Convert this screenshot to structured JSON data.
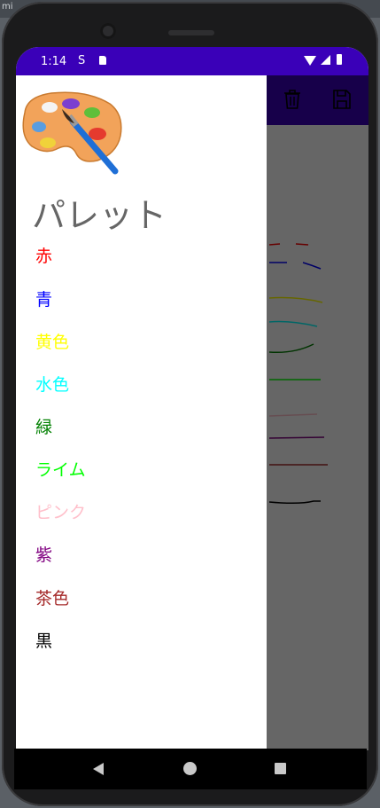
{
  "ide": {
    "label": "mi"
  },
  "status_bar": {
    "time": "1:14",
    "sync_icon": "S"
  },
  "app_bar": {
    "actions": [
      "trash-icon",
      "save-icon"
    ]
  },
  "drawer": {
    "title": "パレット",
    "logo": "palette-icon",
    "items": [
      {
        "label": "赤",
        "color": "#ff0000"
      },
      {
        "label": "青",
        "color": "#0000ff"
      },
      {
        "label": "黄色",
        "color": "#ffff00"
      },
      {
        "label": "水色",
        "color": "#00ffff"
      },
      {
        "label": "緑",
        "color": "#008000"
      },
      {
        "label": "ライム",
        "color": "#00ff00"
      },
      {
        "label": "ピンク",
        "color": "#ffc0cb"
      },
      {
        "label": "紫",
        "color": "#800080"
      },
      {
        "label": "茶色",
        "color": "#a52a2a"
      },
      {
        "label": "黒",
        "color": "#000000"
      }
    ]
  },
  "nav_bar": {
    "buttons": [
      "back-icon",
      "home-icon",
      "recents-icon"
    ]
  }
}
